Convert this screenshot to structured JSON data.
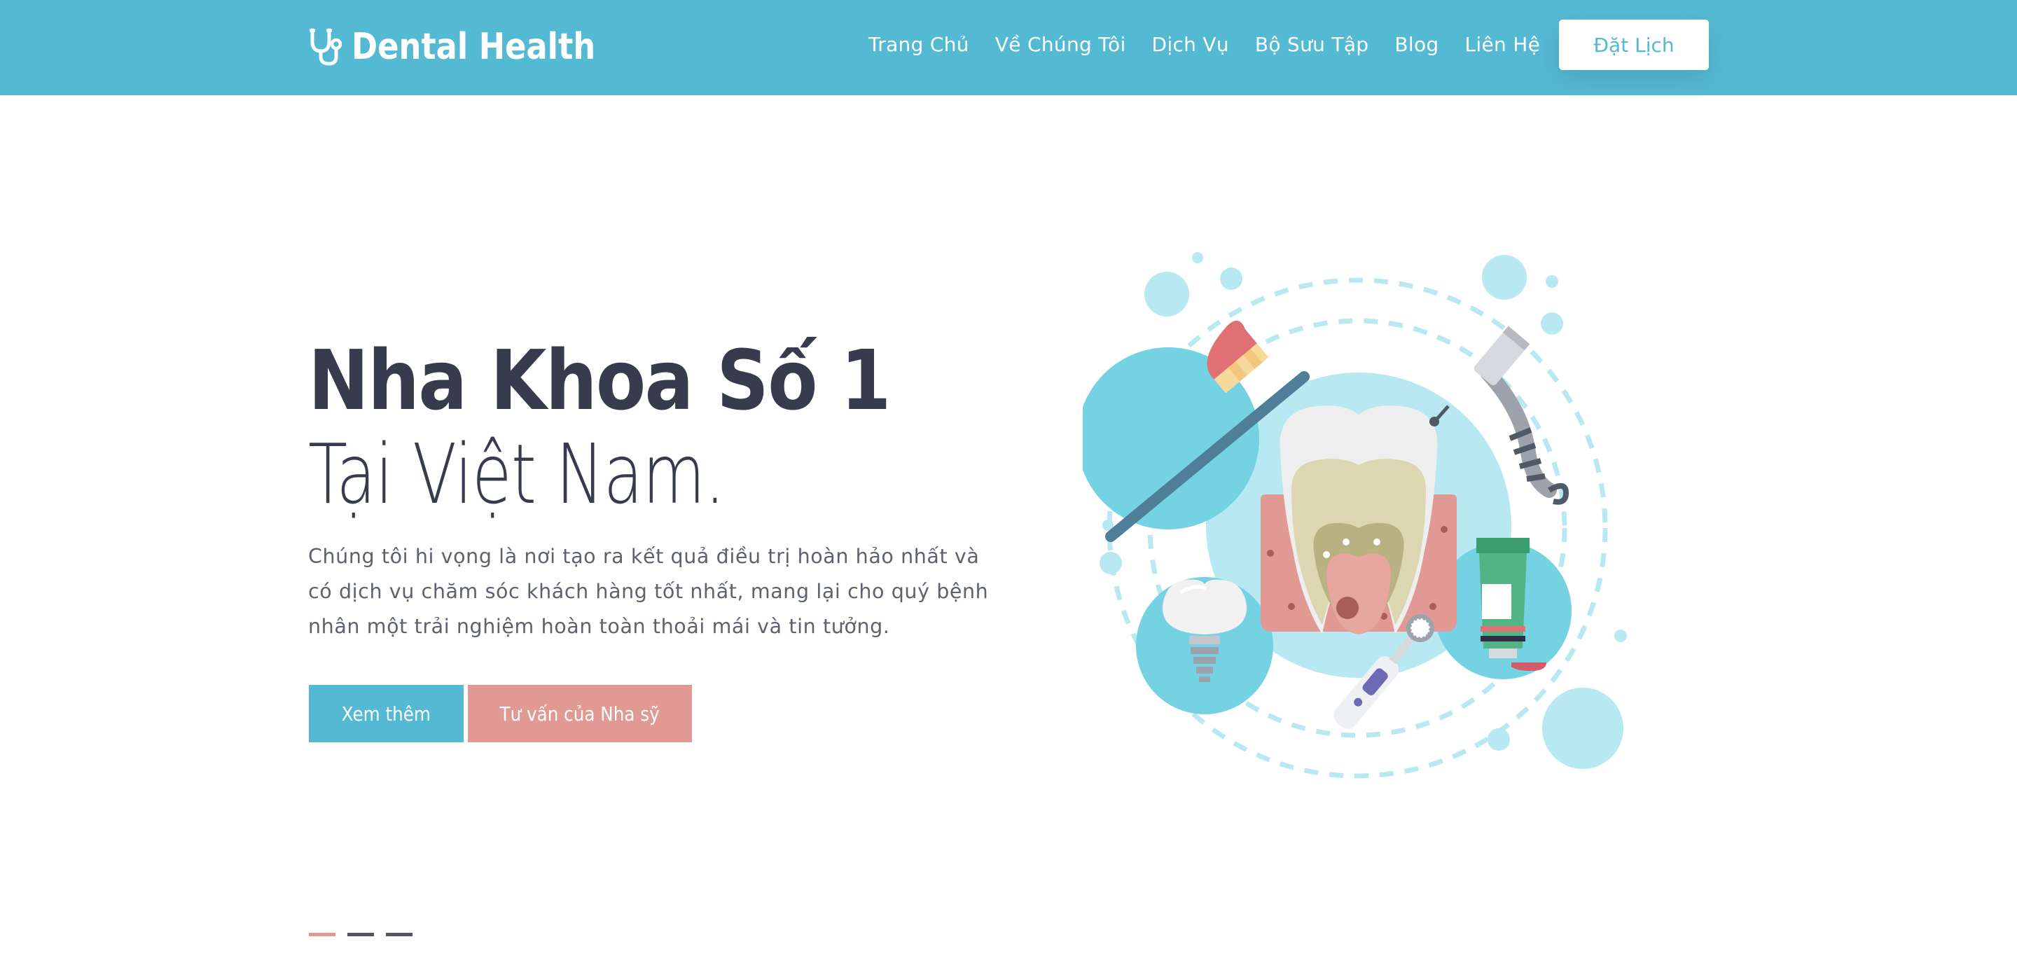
{
  "brand": {
    "name": "Dental Health",
    "icon": "stethoscope-icon"
  },
  "nav": {
    "items": [
      {
        "label": "Trang Chủ"
      },
      {
        "label": "Về Chúng Tôi"
      },
      {
        "label": "Dịch Vụ"
      },
      {
        "label": "Bộ Sưu Tập"
      },
      {
        "label": "Blog"
      },
      {
        "label": "Liên Hệ"
      }
    ],
    "cta_label": "Đặt Lịch"
  },
  "hero": {
    "title_bold": "Nha Khoa Số 1",
    "title_light": "Tại Việt Nam.",
    "description": "Chúng tôi hi vọng là nơi tạo ra kết quả điều trị hoàn hảo nhất và có dịch vụ chăm sóc khách hàng tốt nhất, mang lại cho quý bệnh nhân một trải nghiệm hoàn toàn thoải mái và tin tưởng.",
    "primary_button": "Xem thêm",
    "secondary_button": "Tư vấn của Nha sỹ",
    "illustration_icons": [
      "tooth-icon",
      "toothbrush-icon",
      "dental-drill-icon",
      "toothpaste-icon",
      "dental-implant-icon",
      "electric-toothbrush-icon"
    ]
  },
  "slider": {
    "dots": 3,
    "active_index": 0
  },
  "colors": {
    "primary": "#54b9d3",
    "accent": "#e19993",
    "heading": "#373b4d",
    "body_text": "#5d6170",
    "light_blue": "#b8e8f2",
    "mid_blue": "#74d2e2"
  }
}
